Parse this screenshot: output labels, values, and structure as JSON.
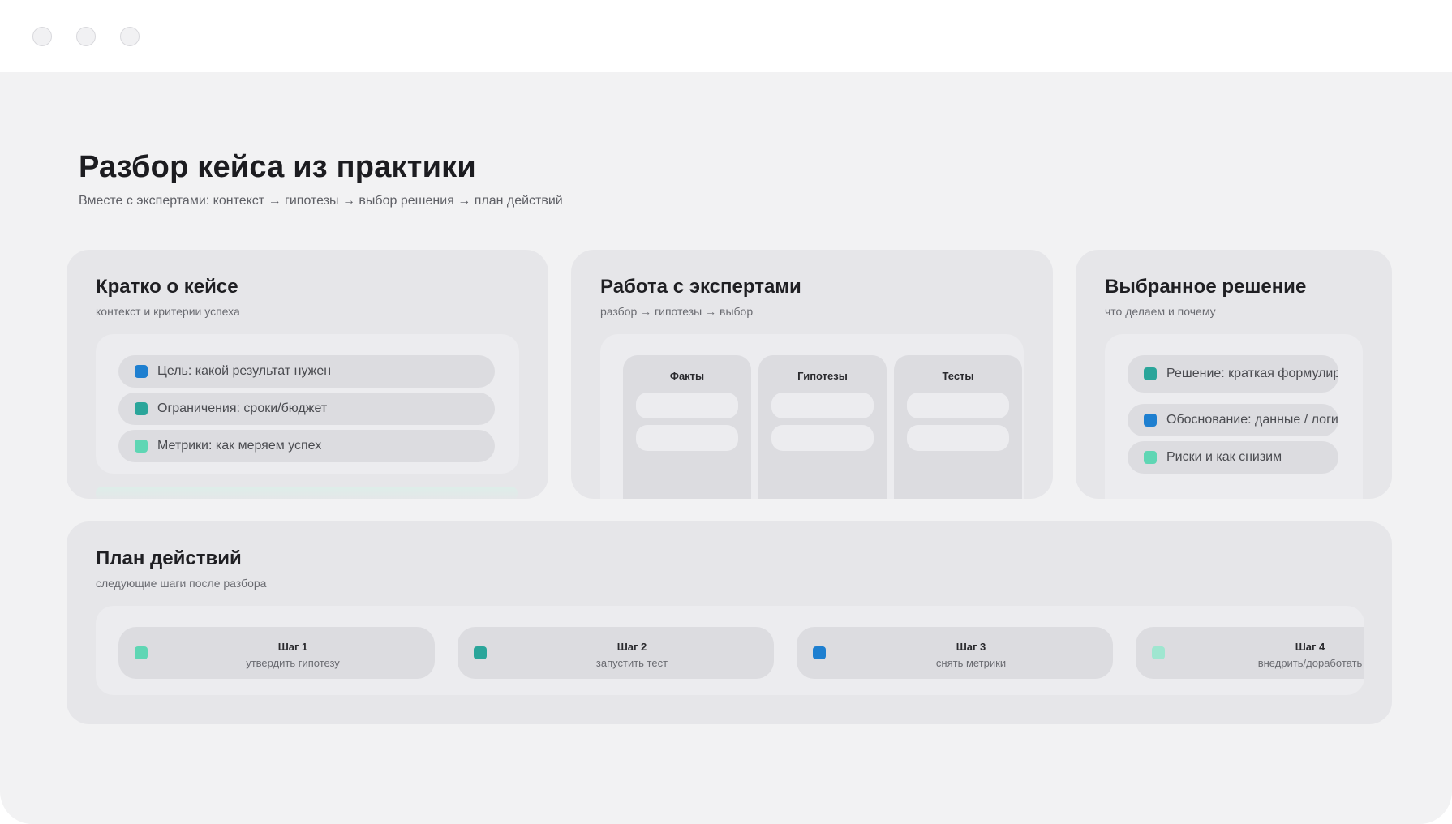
{
  "window": {
    "controls": [
      "close-dot",
      "minimize-dot",
      "maximize-dot"
    ]
  },
  "header": {
    "title": "Разбор кейса из практики",
    "subtitle": "Вместе с экспертами: контекст → гипотезы → выбор решения → план действий"
  },
  "colors": {
    "blue": "#1e7fd0",
    "teal": "#2aa59a",
    "mint": "#5fd6b4",
    "mint_light": "#9fe6d0"
  },
  "case_card": {
    "title": "Кратко о кейсе",
    "subtitle": "контекст и критерии успеха",
    "items": [
      {
        "label": "Цель: какой результат нужен",
        "color": "blue"
      },
      {
        "label": "Ограничения: сроки/бюджет",
        "color": "teal"
      },
      {
        "label": "Метрики: как меряем успех",
        "color": "mint"
      }
    ]
  },
  "experts_card": {
    "title": "Работа с экспертами",
    "subtitle": "разбор → гипотезы → выбор",
    "columns": [
      {
        "title": "Факты"
      },
      {
        "title": "Гипотезы"
      },
      {
        "title": "Тесты"
      }
    ]
  },
  "solution_card": {
    "title": "Выбранное решение",
    "subtitle": "что делаем и почему",
    "items": [
      {
        "label": "Решение: краткая формулировка",
        "color": "teal"
      },
      {
        "label": "Обоснование: данные / логика",
        "color": "blue"
      },
      {
        "label": "Риски и как снизим",
        "color": "mint"
      }
    ]
  },
  "plan_card": {
    "title": "План действий",
    "subtitle": "следующие шаги после разбора",
    "steps": [
      {
        "title": "Шаг 1",
        "desc": "утвердить гипотезу",
        "color": "mint"
      },
      {
        "title": "Шаг 2",
        "desc": "запустить тест",
        "color": "teal"
      },
      {
        "title": "Шаг 3",
        "desc": "снять метрики",
        "color": "blue"
      },
      {
        "title": "Шаг 4",
        "desc": "внедрить/доработать",
        "color": "mint_light"
      }
    ]
  }
}
